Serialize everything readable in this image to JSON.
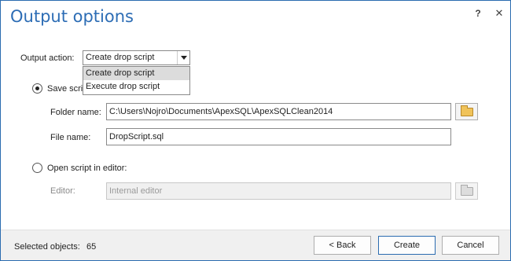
{
  "dialog": {
    "title": "Output options",
    "help_label": "?",
    "close_label": "✕"
  },
  "output_action": {
    "label": "Output action:",
    "selected": "Create drop script",
    "options": [
      "Create drop script",
      "Execute drop script"
    ]
  },
  "save_script": {
    "label": "Save scri",
    "checked": true,
    "folder_label": "Folder name:",
    "folder_value": "C:\\Users\\Nojro\\Documents\\ApexSQL\\ApexSQLClean2014",
    "file_label": "File name:",
    "file_value": "DropScript.sql"
  },
  "open_editor": {
    "label": "Open script in editor:",
    "checked": false,
    "editor_label": "Editor:",
    "editor_value": "Internal editor"
  },
  "footer": {
    "selected_objects_label": "Selected objects:",
    "selected_objects_count": "65",
    "back_label": "< Back",
    "create_label": "Create",
    "cancel_label": "Cancel"
  },
  "colors": {
    "title": "#2d6db5",
    "border": "#2b6cb0",
    "footer_bg": "#f0f0f0"
  }
}
